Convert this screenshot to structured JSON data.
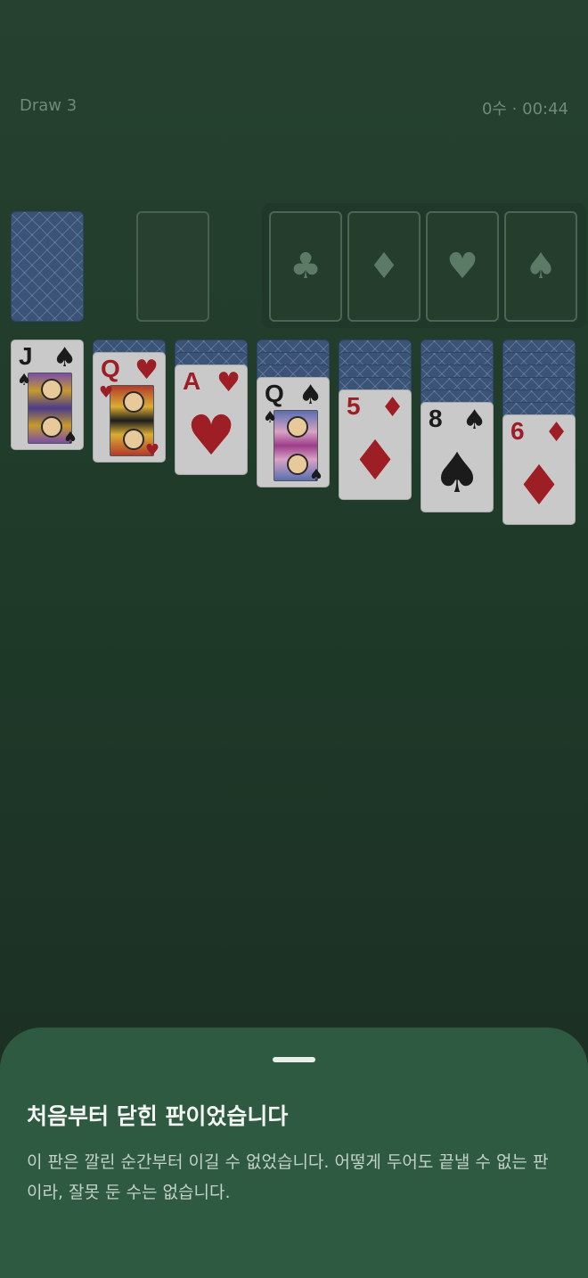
{
  "header": {
    "mode": "Draw 3",
    "stats": "0수 · 00:44"
  },
  "foundations": [
    {
      "suit": "♣",
      "icon": "club-icon"
    },
    {
      "suit": "♦",
      "icon": "diamond-icon"
    },
    {
      "suit": "♥",
      "icon": "heart-icon"
    },
    {
      "suit": "♠",
      "icon": "spade-icon"
    }
  ],
  "tableau": [
    {
      "hidden": 0,
      "rank": "J",
      "suit": "♠",
      "color": "black",
      "face": true
    },
    {
      "hidden": 1,
      "rank": "Q",
      "suit": "♥",
      "color": "red",
      "face": true
    },
    {
      "hidden": 2,
      "rank": "A",
      "suit": "♥",
      "color": "red",
      "face": false
    },
    {
      "hidden": 3,
      "rank": "Q",
      "suit": "♠",
      "color": "black",
      "face": true
    },
    {
      "hidden": 4,
      "rank": "5",
      "suit": "♦",
      "color": "red",
      "face": false
    },
    {
      "hidden": 5,
      "rank": "8",
      "suit": "♠",
      "color": "black",
      "face": false
    },
    {
      "hidden": 6,
      "rank": "6",
      "suit": "♦",
      "color": "red",
      "face": false
    }
  ],
  "sheet": {
    "title": "처음부터 닫힌 판이었습니다",
    "body": "이 판은 깔린 순간부터 이길 수 없었습니다. 어떻게 두어도 끝낼 수 없는 판이라, 잘못 둔 수는 없습니다."
  }
}
